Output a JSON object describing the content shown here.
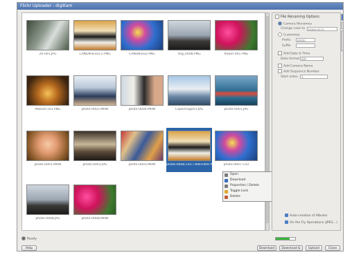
{
  "window": {
    "title": "Flickr Uploader - digiKam"
  },
  "photos": [
    {
      "caption": "20-001.JPG",
      "kind": "stone"
    },
    {
      "caption": "CANON-B310-2.PNG",
      "kind": "penguins"
    },
    {
      "caption": "CANON-B32.PNG",
      "kind": "reef"
    },
    {
      "caption": "img_0008.PNG",
      "kind": "dusk"
    },
    {
      "caption": "flower-001.PNG",
      "kind": "flowers"
    },
    {
      "caption": "P6810r-101.PNG",
      "kind": "arch"
    },
    {
      "caption": "photo-0001.MRW",
      "kind": "hooded"
    },
    {
      "caption": "photo-0004.MRW",
      "kind": "woman"
    },
    {
      "caption": "Copenhagen5.JPG",
      "kind": "harbor"
    },
    {
      "caption": "photo-0001.JPG",
      "kind": "rock"
    },
    {
      "caption": "photo-0001.MRW",
      "kind": "child"
    },
    {
      "caption": "photo-0003.JPG",
      "kind": "room"
    },
    {
      "caption": "photo-0003.MRW",
      "kind": "crowd"
    },
    {
      "caption": "photo-0008.CR2 / 800×600 PNG",
      "kind": "penguins",
      "selected": true
    },
    {
      "caption": "photo-0007.CR2",
      "kind": "reef"
    },
    {
      "caption": "photo-0008.JPG",
      "kind": "dusk"
    },
    {
      "caption": "photo-0008.MRW",
      "kind": "flowers"
    }
  ],
  "context_menu": [
    {
      "label": "Open",
      "color": "#7b7b7b"
    },
    {
      "label": "Download",
      "color": "#3a6ab8"
    },
    {
      "label": "Properties / Delete",
      "color": "#7b7b7b"
    },
    {
      "label": "Toggle Lock",
      "color": "#e0a52a"
    },
    {
      "label": "Delete",
      "color": "#c45a3a"
    }
  ],
  "panel": {
    "title": "File Renaming Options",
    "camera_filenames": "Camera filenames",
    "change_case_label": "Change case to",
    "change_case_value": "Leave as is",
    "customize": "Customize",
    "prefix_label": "Prefix",
    "prefix_value": "photo",
    "suffix_label": "Suffix",
    "add_date": "Add Date & Time",
    "date_format_label": "Date format",
    "date_format_value": "ISO",
    "add_camera_name": "Add Camera Name",
    "add_sequence": "Add Sequence Number",
    "start_index_label": "Start index",
    "start_index_value": "1"
  },
  "bottom_tabs": {
    "auto_creation": "Auto-creation of Albums",
    "on_the_fly": "On the Fly Operations (JPEG...)"
  },
  "status": {
    "ready": "Ready",
    "progress": 0.7
  },
  "buttons": {
    "help": "Help",
    "download": "Download",
    "download_delete": "Download & Delete",
    "upload": "Upload",
    "close": "Close"
  }
}
